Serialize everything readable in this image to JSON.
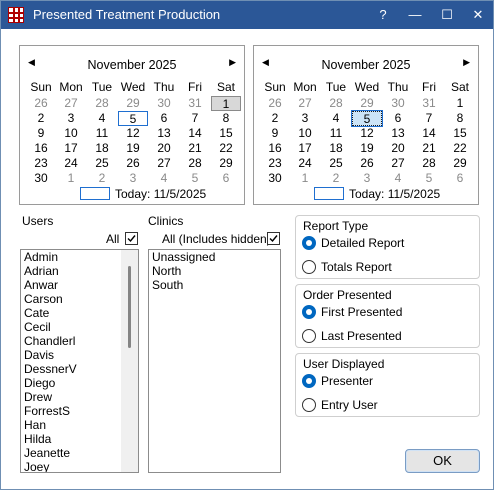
{
  "window": {
    "title": "Presented Treatment Production",
    "help_label": "?",
    "minimize_label": "—",
    "maximize_label": "☐",
    "close_label": "✕"
  },
  "calendars": [
    {
      "month_label": "November 2025",
      "prev_label": "◀",
      "next_label": "▶",
      "day_headers": [
        "Sun",
        "Mon",
        "Tue",
        "Wed",
        "Thu",
        "Fri",
        "Sat"
      ],
      "weeks": [
        [
          "26",
          "27",
          "28",
          "29",
          "30",
          "31",
          "1"
        ],
        [
          "2",
          "3",
          "4",
          "5",
          "6",
          "7",
          "8"
        ],
        [
          "9",
          "10",
          "11",
          "12",
          "13",
          "14",
          "15"
        ],
        [
          "16",
          "17",
          "18",
          "19",
          "20",
          "21",
          "22"
        ],
        [
          "23",
          "24",
          "25",
          "26",
          "27",
          "28",
          "29"
        ],
        [
          "30",
          "1",
          "2",
          "3",
          "4",
          "5",
          "6"
        ]
      ],
      "today_label": "Today: 11/5/2025"
    },
    {
      "month_label": "November 2025",
      "prev_label": "◀",
      "next_label": "▶",
      "day_headers": [
        "Sun",
        "Mon",
        "Tue",
        "Wed",
        "Thu",
        "Fri",
        "Sat"
      ],
      "weeks": [
        [
          "26",
          "27",
          "28",
          "29",
          "30",
          "31",
          "1"
        ],
        [
          "2",
          "3",
          "4",
          "5",
          "6",
          "7",
          "8"
        ],
        [
          "9",
          "10",
          "11",
          "12",
          "13",
          "14",
          "15"
        ],
        [
          "16",
          "17",
          "18",
          "19",
          "20",
          "21",
          "22"
        ],
        [
          "23",
          "24",
          "25",
          "26",
          "27",
          "28",
          "29"
        ],
        [
          "30",
          "1",
          "2",
          "3",
          "4",
          "5",
          "6"
        ]
      ],
      "today_label": "Today: 11/5/2025"
    }
  ],
  "users": {
    "label": "Users",
    "all_label": "All",
    "all_checked": true,
    "items": [
      "Admin",
      "Adrian",
      "Anwar",
      "Carson",
      "Cate",
      "Cecil",
      "Chandlerl",
      "Davis",
      "DessnerV",
      "Diego",
      "Drew",
      "ForrestS",
      "Han",
      "Hilda",
      "Jeanette",
      "Joey"
    ]
  },
  "clinics": {
    "label": "Clinics",
    "all_label": "All (Includes hidden)",
    "all_checked": true,
    "items": [
      "Unassigned",
      "North",
      "South"
    ]
  },
  "report_type": {
    "title": "Report Type",
    "options": [
      "Detailed Report",
      "Totals Report"
    ],
    "selected": "Detailed Report"
  },
  "order_presented": {
    "title": "Order Presented",
    "options": [
      "First Presented",
      "Last Presented"
    ],
    "selected": "First Presented"
  },
  "user_displayed": {
    "title": "User Displayed",
    "options": [
      "Presenter",
      "Entry User"
    ],
    "selected": "Presenter"
  },
  "ok_label": "OK",
  "colors": {
    "titlebar": "#2b5797",
    "accent": "#0067c0",
    "today_border": "#1f6fd0"
  }
}
